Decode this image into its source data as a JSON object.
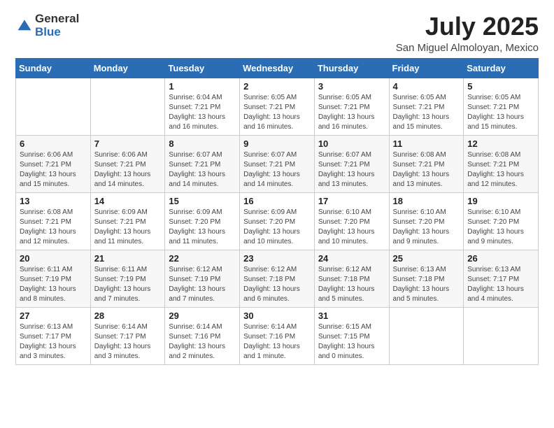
{
  "header": {
    "logo_general": "General",
    "logo_blue": "Blue",
    "month": "July 2025",
    "location": "San Miguel Almoloyan, Mexico"
  },
  "days_of_week": [
    "Sunday",
    "Monday",
    "Tuesday",
    "Wednesday",
    "Thursday",
    "Friday",
    "Saturday"
  ],
  "weeks": [
    [
      {
        "day": "",
        "info": ""
      },
      {
        "day": "",
        "info": ""
      },
      {
        "day": "1",
        "info": "Sunrise: 6:04 AM\nSunset: 7:21 PM\nDaylight: 13 hours\nand 16 minutes."
      },
      {
        "day": "2",
        "info": "Sunrise: 6:05 AM\nSunset: 7:21 PM\nDaylight: 13 hours\nand 16 minutes."
      },
      {
        "day": "3",
        "info": "Sunrise: 6:05 AM\nSunset: 7:21 PM\nDaylight: 13 hours\nand 16 minutes."
      },
      {
        "day": "4",
        "info": "Sunrise: 6:05 AM\nSunset: 7:21 PM\nDaylight: 13 hours\nand 15 minutes."
      },
      {
        "day": "5",
        "info": "Sunrise: 6:05 AM\nSunset: 7:21 PM\nDaylight: 13 hours\nand 15 minutes."
      }
    ],
    [
      {
        "day": "6",
        "info": "Sunrise: 6:06 AM\nSunset: 7:21 PM\nDaylight: 13 hours\nand 15 minutes."
      },
      {
        "day": "7",
        "info": "Sunrise: 6:06 AM\nSunset: 7:21 PM\nDaylight: 13 hours\nand 14 minutes."
      },
      {
        "day": "8",
        "info": "Sunrise: 6:07 AM\nSunset: 7:21 PM\nDaylight: 13 hours\nand 14 minutes."
      },
      {
        "day": "9",
        "info": "Sunrise: 6:07 AM\nSunset: 7:21 PM\nDaylight: 13 hours\nand 14 minutes."
      },
      {
        "day": "10",
        "info": "Sunrise: 6:07 AM\nSunset: 7:21 PM\nDaylight: 13 hours\nand 13 minutes."
      },
      {
        "day": "11",
        "info": "Sunrise: 6:08 AM\nSunset: 7:21 PM\nDaylight: 13 hours\nand 13 minutes."
      },
      {
        "day": "12",
        "info": "Sunrise: 6:08 AM\nSunset: 7:21 PM\nDaylight: 13 hours\nand 12 minutes."
      }
    ],
    [
      {
        "day": "13",
        "info": "Sunrise: 6:08 AM\nSunset: 7:21 PM\nDaylight: 13 hours\nand 12 minutes."
      },
      {
        "day": "14",
        "info": "Sunrise: 6:09 AM\nSunset: 7:21 PM\nDaylight: 13 hours\nand 11 minutes."
      },
      {
        "day": "15",
        "info": "Sunrise: 6:09 AM\nSunset: 7:20 PM\nDaylight: 13 hours\nand 11 minutes."
      },
      {
        "day": "16",
        "info": "Sunrise: 6:09 AM\nSunset: 7:20 PM\nDaylight: 13 hours\nand 10 minutes."
      },
      {
        "day": "17",
        "info": "Sunrise: 6:10 AM\nSunset: 7:20 PM\nDaylight: 13 hours\nand 10 minutes."
      },
      {
        "day": "18",
        "info": "Sunrise: 6:10 AM\nSunset: 7:20 PM\nDaylight: 13 hours\nand 9 minutes."
      },
      {
        "day": "19",
        "info": "Sunrise: 6:10 AM\nSunset: 7:20 PM\nDaylight: 13 hours\nand 9 minutes."
      }
    ],
    [
      {
        "day": "20",
        "info": "Sunrise: 6:11 AM\nSunset: 7:19 PM\nDaylight: 13 hours\nand 8 minutes."
      },
      {
        "day": "21",
        "info": "Sunrise: 6:11 AM\nSunset: 7:19 PM\nDaylight: 13 hours\nand 7 minutes."
      },
      {
        "day": "22",
        "info": "Sunrise: 6:12 AM\nSunset: 7:19 PM\nDaylight: 13 hours\nand 7 minutes."
      },
      {
        "day": "23",
        "info": "Sunrise: 6:12 AM\nSunset: 7:18 PM\nDaylight: 13 hours\nand 6 minutes."
      },
      {
        "day": "24",
        "info": "Sunrise: 6:12 AM\nSunset: 7:18 PM\nDaylight: 13 hours\nand 5 minutes."
      },
      {
        "day": "25",
        "info": "Sunrise: 6:13 AM\nSunset: 7:18 PM\nDaylight: 13 hours\nand 5 minutes."
      },
      {
        "day": "26",
        "info": "Sunrise: 6:13 AM\nSunset: 7:17 PM\nDaylight: 13 hours\nand 4 minutes."
      }
    ],
    [
      {
        "day": "27",
        "info": "Sunrise: 6:13 AM\nSunset: 7:17 PM\nDaylight: 13 hours\nand 3 minutes."
      },
      {
        "day": "28",
        "info": "Sunrise: 6:14 AM\nSunset: 7:17 PM\nDaylight: 13 hours\nand 3 minutes."
      },
      {
        "day": "29",
        "info": "Sunrise: 6:14 AM\nSunset: 7:16 PM\nDaylight: 13 hours\nand 2 minutes."
      },
      {
        "day": "30",
        "info": "Sunrise: 6:14 AM\nSunset: 7:16 PM\nDaylight: 13 hours\nand 1 minute."
      },
      {
        "day": "31",
        "info": "Sunrise: 6:15 AM\nSunset: 7:15 PM\nDaylight: 13 hours\nand 0 minutes."
      },
      {
        "day": "",
        "info": ""
      },
      {
        "day": "",
        "info": ""
      }
    ]
  ]
}
